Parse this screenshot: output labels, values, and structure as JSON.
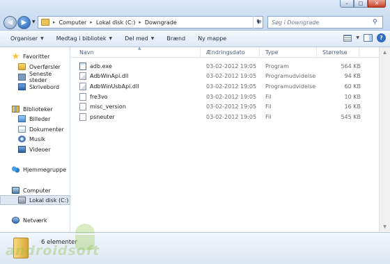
{
  "window": {
    "title_controls": [
      "–",
      "□",
      "✕"
    ]
  },
  "address_bar": {
    "crumbs": [
      "Computer",
      "Lokal disk (C:)",
      "Downgrade"
    ]
  },
  "search": {
    "placeholder": "Søg i Downgrade"
  },
  "toolbar": {
    "organize": "Organiser",
    "include_in_library": "Medtag i bibliotek",
    "share_with": "Del med",
    "burn": "Brænd",
    "new_folder": "Ny mappe"
  },
  "nav": {
    "favorites": "Favoritter",
    "downloads": "Overførsler",
    "recent": "Seneste steder",
    "desktop": "Skrivebord",
    "libraries": "Biblioteker",
    "pictures": "Billeder",
    "documents": "Dokumenter",
    "music": "Musik",
    "videos": "Videoer",
    "homegroup": "Hjemmegruppe",
    "computer": "Computer",
    "local_disk": "Lokal disk (C:)",
    "network": "Netværk"
  },
  "columns": {
    "name": "Navn",
    "date": "Ændringsdato",
    "type": "Type",
    "size": "Størrelse"
  },
  "files": [
    {
      "name": "adb.exe",
      "date": "03-02-2012 19:05",
      "type": "Program",
      "size": "564 KB",
      "icon": "exe-icon"
    },
    {
      "name": "AdbWinApi.dll",
      "date": "03-02-2012 19:05",
      "type": "Programudvidelse",
      "size": "94 KB",
      "icon": "dll-icon"
    },
    {
      "name": "AdbWinUsbApi.dll",
      "date": "03-02-2012 19:05",
      "type": "Programudvidelse",
      "size": "60 KB",
      "icon": "dll-icon"
    },
    {
      "name": "fre3vo",
      "date": "03-02-2012 19:05",
      "type": "Fil",
      "size": "10 KB",
      "icon": "file-icon"
    },
    {
      "name": "misc_version",
      "date": "03-02-2012 19:05",
      "type": "Fil",
      "size": "16 KB",
      "icon": "file-icon"
    },
    {
      "name": "psneuter",
      "date": "03-02-2012 19:05",
      "type": "Fil",
      "size": "545 KB",
      "icon": "file-icon"
    }
  ],
  "status": {
    "item_count": "6 elementer"
  },
  "watermark": "androidsoft"
}
